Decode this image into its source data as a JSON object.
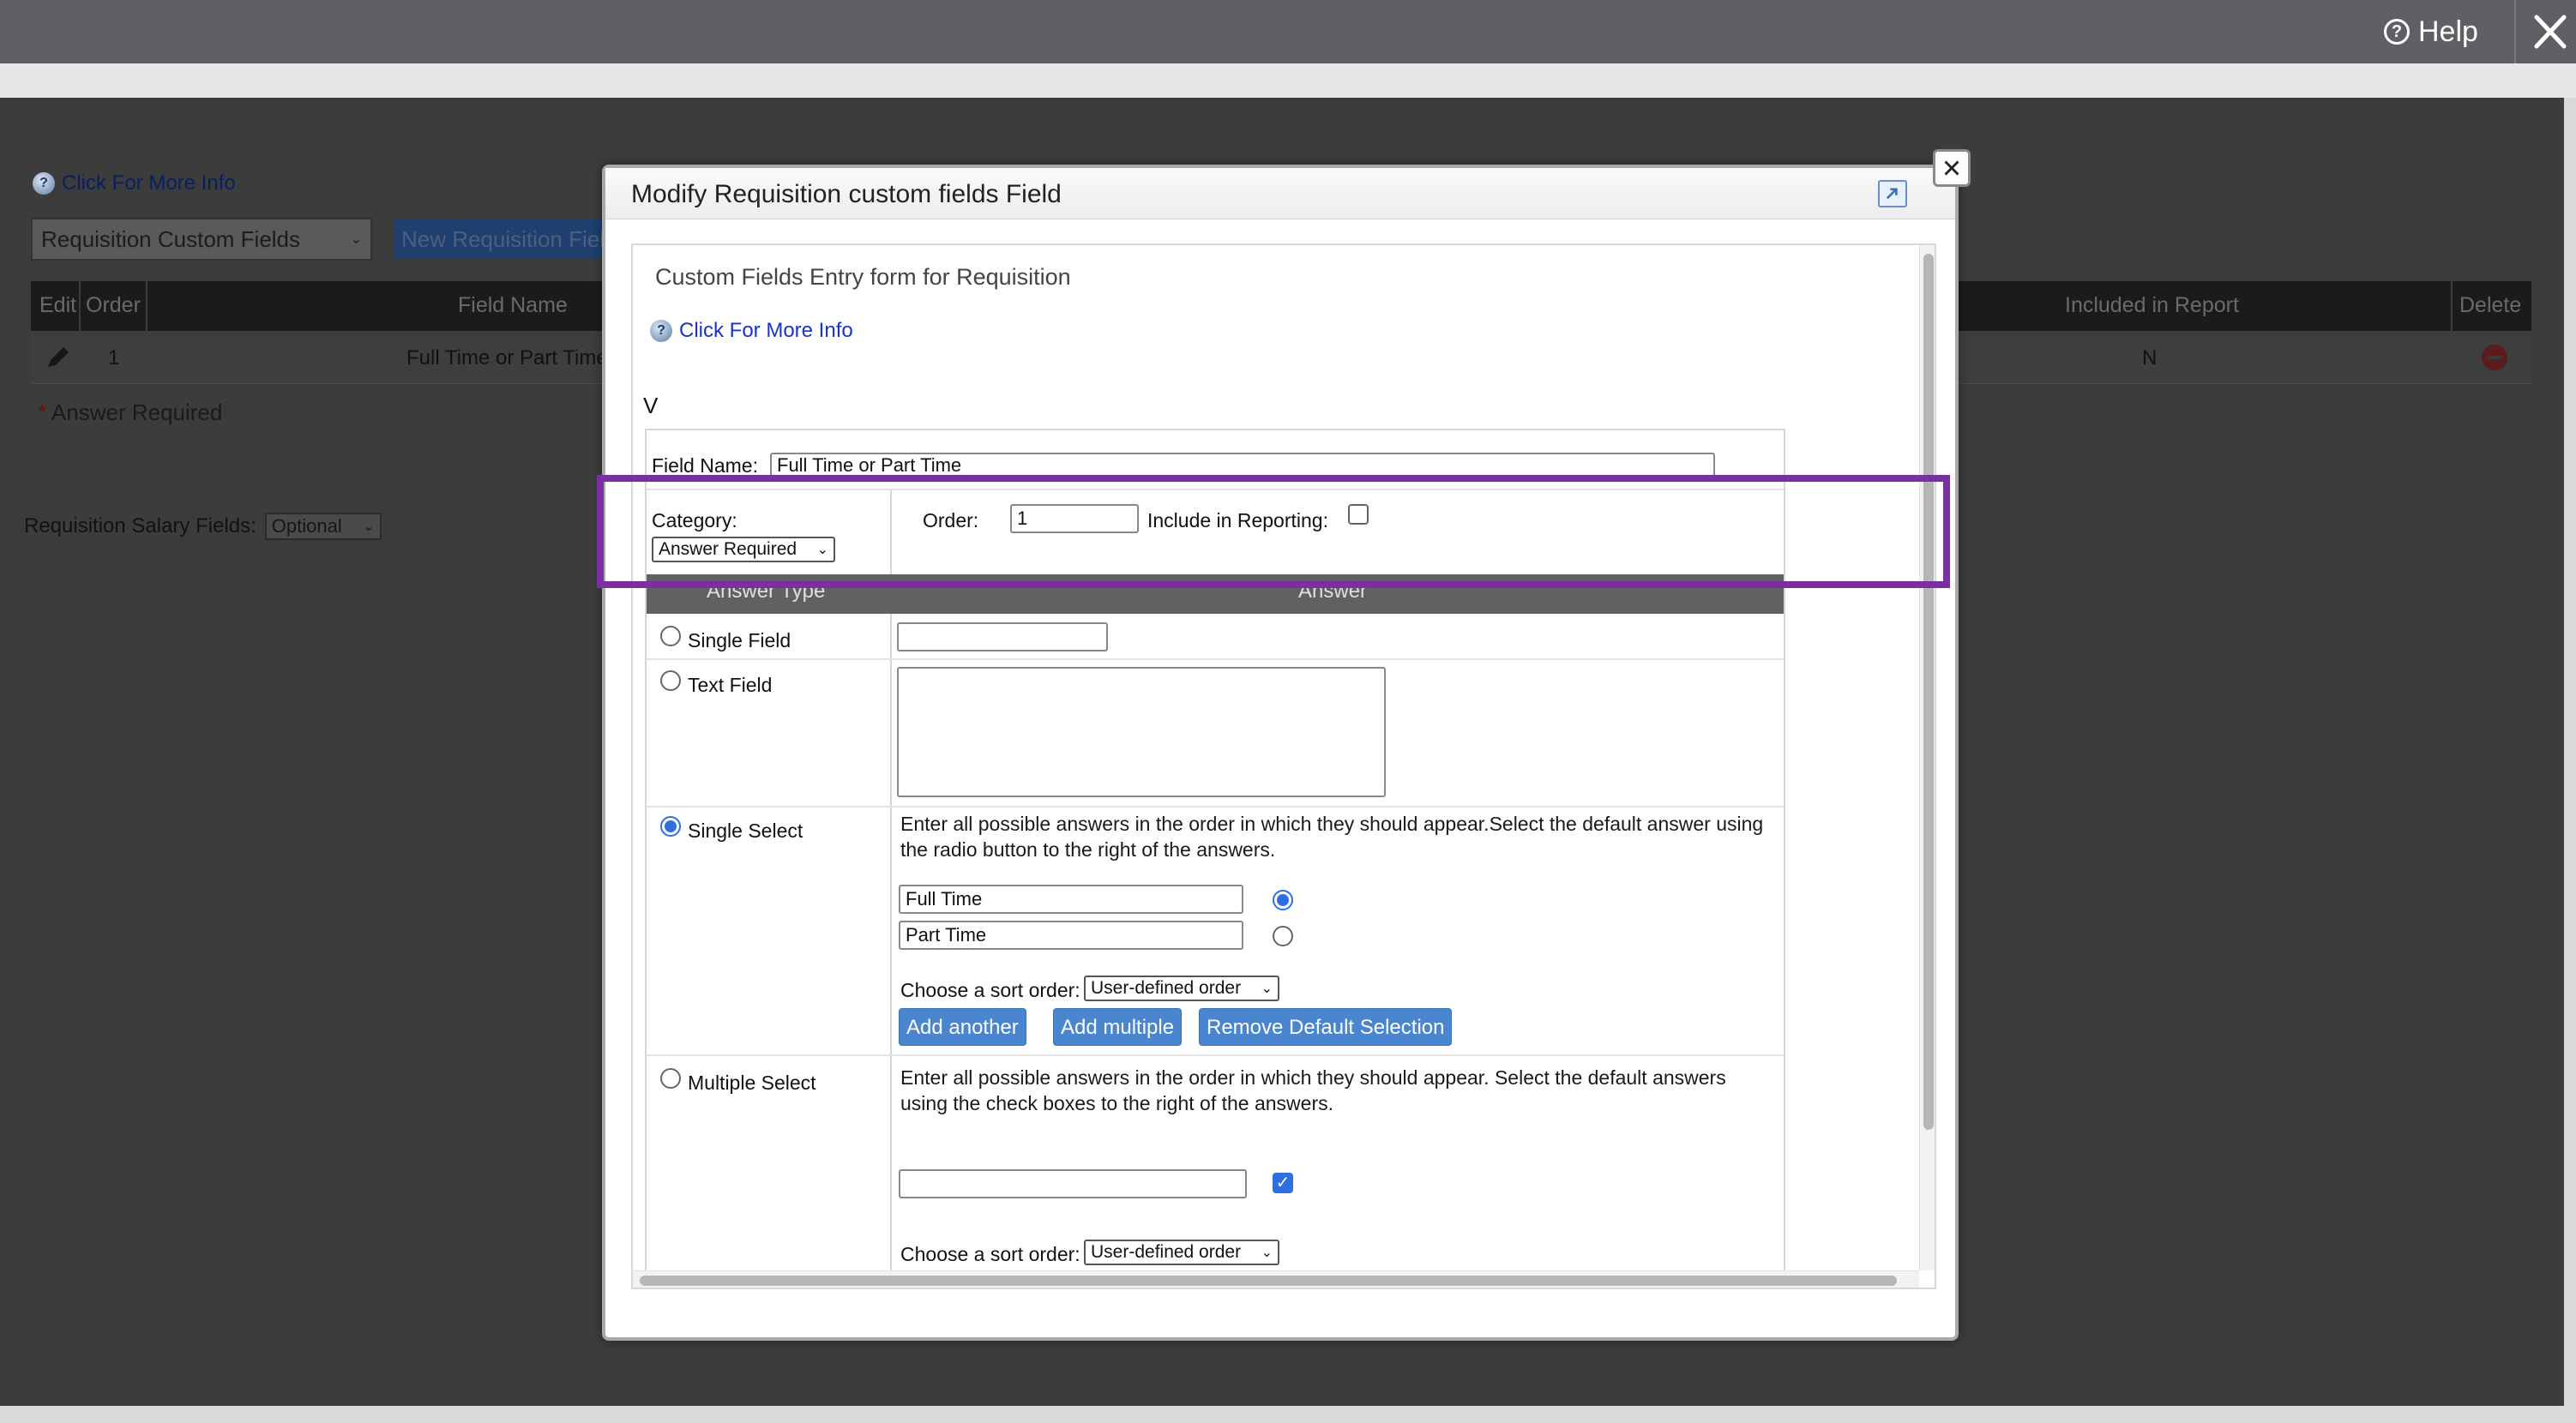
{
  "topbar": {
    "help_label": "Help"
  },
  "background": {
    "info_link": "Click For More Info",
    "select_value": "Requisition Custom Fields",
    "new_button": "New Requisition Field",
    "table": {
      "headers": [
        "Edit",
        "Order",
        "Field Name",
        "Included in Report",
        "Delete"
      ],
      "row": {
        "order": "1",
        "field_name": "Full Time or Part Time",
        "included": "N"
      }
    },
    "required_note": "Answer Required",
    "salary_label": "Requisition Salary Fields:",
    "salary_value": "Optional"
  },
  "modal": {
    "title": "Modify Requisition custom fields Field",
    "form_heading": "Custom Fields Entry form for Requisition",
    "info_link": "Click For More Info",
    "v_marker": "V",
    "field_name_label": "Field Name:",
    "field_name_value": "Full Time or Part Time",
    "category_label": "Category:",
    "category_value": "Answer Required",
    "order_label": "Order:",
    "order_value": "1",
    "reporting_label": "Include in Reporting:",
    "col_answer_type": "Answer Type",
    "col_answer": "Answer",
    "answer_types": {
      "single_field": "Single Field",
      "text_field": "Text Field",
      "single_select": "Single Select",
      "multiple_select": "Multiple Select"
    },
    "single_select": {
      "instructions": "Enter all possible answers in the order in which they should appear.Select the default answer using the radio button to the right of the answers.",
      "options": [
        "Full Time",
        "Part Time"
      ],
      "sort_label": "Choose a sort order:",
      "sort_value": "User-defined order",
      "buttons": [
        "Add another",
        "Add multiple",
        "Remove Default Selection"
      ]
    },
    "multiple_select": {
      "instructions": "Enter all possible answers in the order in which they should appear. Select the default answers using the check boxes to the right of the answers.",
      "sort_label": "Choose a sort order:",
      "sort_value": "User-defined order"
    }
  },
  "colors": {
    "accent": "#4a86cf",
    "highlight": "#7a2fa5",
    "topbar": "#5f6063"
  }
}
